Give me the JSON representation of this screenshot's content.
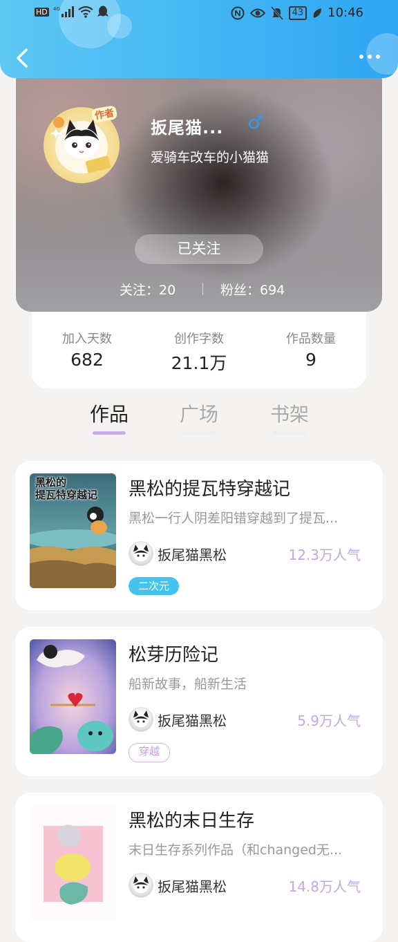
{
  "status_bar": {
    "left_icons": [
      "hd-icon",
      "4g-signal-icon",
      "wifi-icon",
      "qq-icon"
    ],
    "time": "10:46",
    "battery": "43"
  },
  "profile": {
    "name": "扳尾猫...",
    "gender_symbol": "♂",
    "bio": "爱骑车改车的小猫猫",
    "author_badge": "作者",
    "follow_button": "已关注",
    "following_label": "关注：20",
    "fans_label": "粉丝：694"
  },
  "stats": [
    {
      "label": "加入天数",
      "value": "682"
    },
    {
      "label": "创作字数",
      "value": "21.1万"
    },
    {
      "label": "作品数量",
      "value": "9"
    }
  ],
  "tabs": [
    {
      "label": "作品",
      "active": true
    },
    {
      "label": "广场",
      "active": false
    },
    {
      "label": "书架",
      "active": false
    }
  ],
  "books": [
    {
      "title": "黑松的提瓦特穿越记",
      "description": "黑松一行人阴差阳错穿越到了提瓦...",
      "author": "扳尾猫黑松",
      "popularity": "12.3万人气",
      "tag": "二次元",
      "tag_style": "fill",
      "cover_text": "黑松的\n提瓦特穿越记"
    },
    {
      "title": "松芽历险记",
      "description": "船新故事，船新生活",
      "author": "扳尾猫黑松",
      "popularity": "5.9万人气",
      "tag": "穿越",
      "tag_style": "outline"
    },
    {
      "title": "黑松的末日生存",
      "description": "末日生存系列作品（和changed无...",
      "author": "扳尾猫黑松",
      "popularity": "14.8万人气"
    }
  ],
  "colors": {
    "topbar": "#3fb3f3",
    "tab_indicator": "#c4b0e4",
    "popularity": "#c9a4e4",
    "tag_fill": "#44c3ee"
  }
}
